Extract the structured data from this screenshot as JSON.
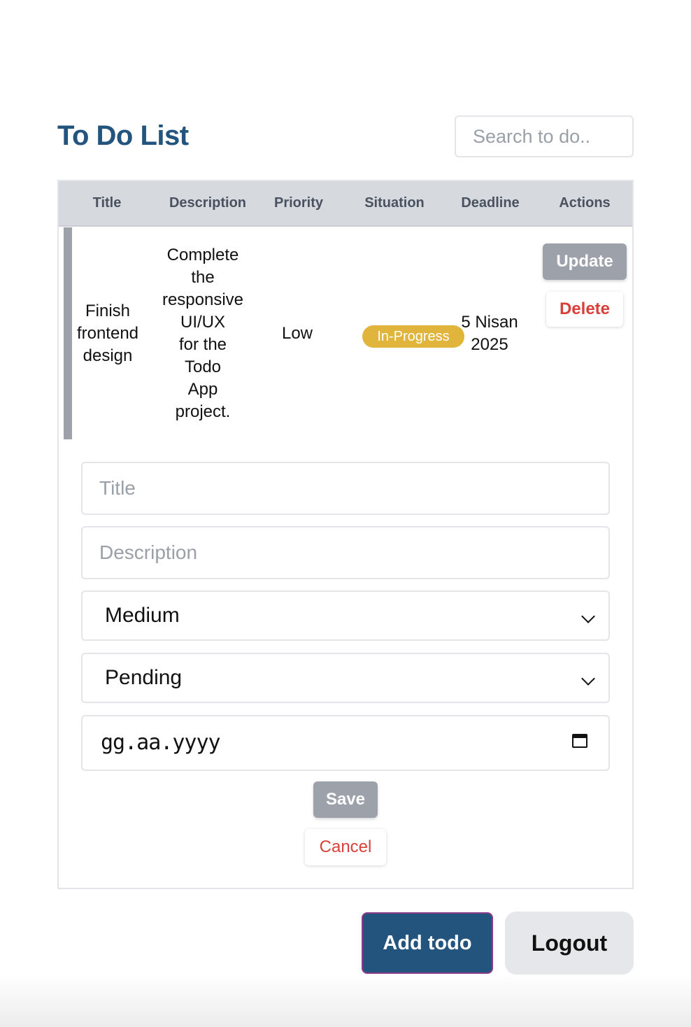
{
  "header": {
    "title": "To Do List",
    "search_placeholder": "Search to do.."
  },
  "table": {
    "columns": [
      "Title",
      "Description",
      "Priority",
      "Situation",
      "Deadline",
      "Actions"
    ],
    "rows": [
      {
        "title": [
          "Finish",
          "frontend",
          "design"
        ],
        "description": [
          "Complete",
          "the",
          "responsive",
          "UI/UX",
          "for the",
          "Todo",
          "App",
          "project."
        ],
        "priority": "Low",
        "situation": "In-Progress",
        "deadline": [
          "5 Nisan",
          "2025"
        ],
        "update_label": "Update",
        "delete_label": "Delete"
      }
    ]
  },
  "form": {
    "title_placeholder": "Title",
    "description_placeholder": "Description",
    "priority_value": "Medium",
    "status_value": "Pending",
    "date_value": "gg.aa.yyyy",
    "save_label": "Save",
    "cancel_label": "Cancel"
  },
  "footer": {
    "add_label": "Add todo",
    "logout_label": "Logout"
  },
  "colors": {
    "brand": "#23547e",
    "badge": "#e1b43b",
    "danger": "#d8403a",
    "muted_button": "#9ca1aa",
    "table_header": "#d6d9de"
  },
  "icons": {
    "select_arrow": "chevron-down-icon",
    "date_picker": "calendar-icon"
  }
}
